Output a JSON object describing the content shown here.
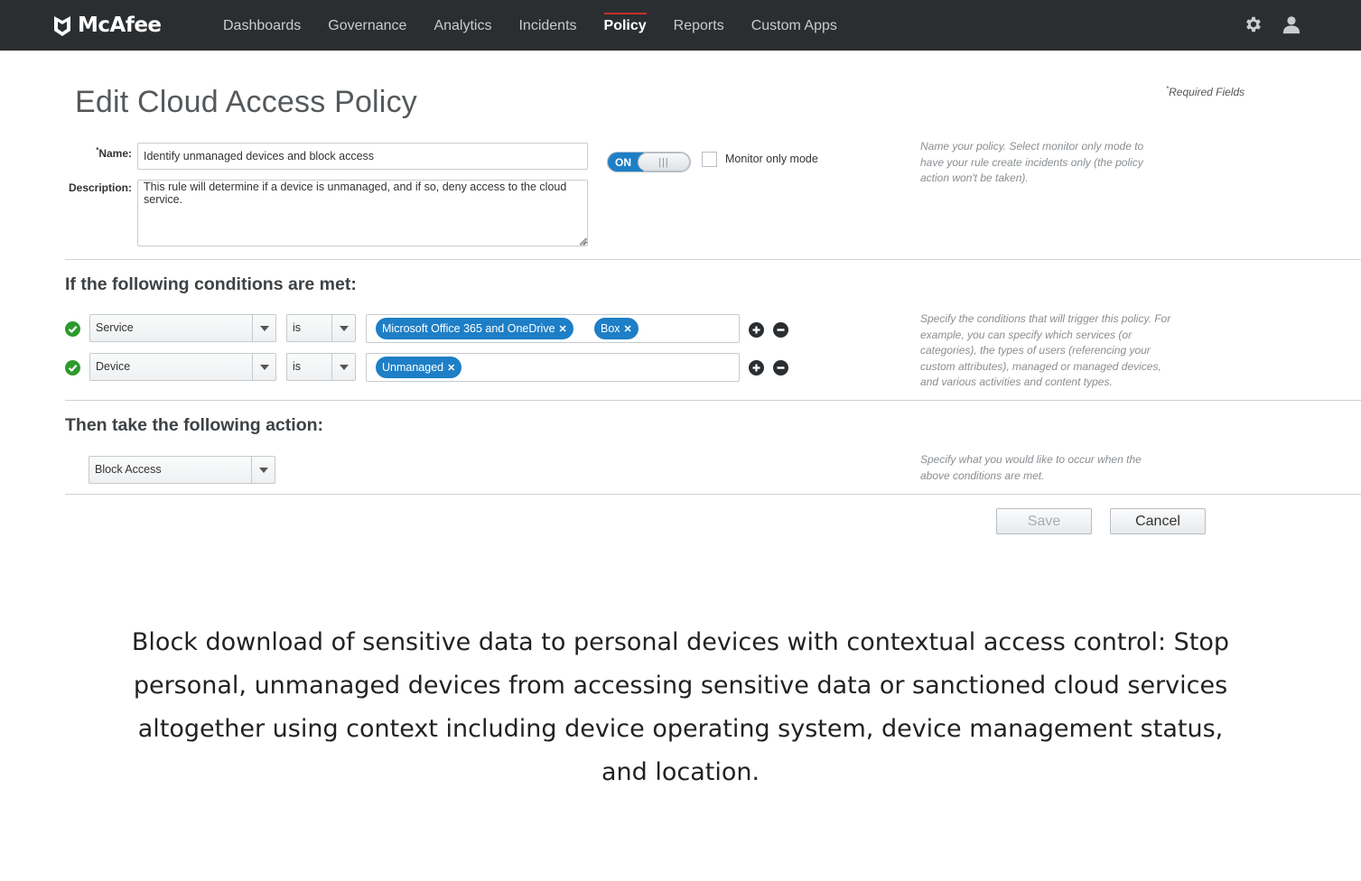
{
  "brand": {
    "name": "McAfee"
  },
  "nav": {
    "items": [
      {
        "label": "Dashboards"
      },
      {
        "label": "Governance"
      },
      {
        "label": "Analytics"
      },
      {
        "label": "Incidents"
      },
      {
        "label": "Policy",
        "active": true
      },
      {
        "label": "Reports"
      },
      {
        "label": "Custom Apps"
      }
    ],
    "icons": [
      "gear-icon",
      "user-icon"
    ]
  },
  "page": {
    "title": "Edit Cloud Access Policy",
    "required_note": "Required Fields",
    "required_mark": "*"
  },
  "form": {
    "name_label": "Name:",
    "name_value": "Identify unmanaged devices and block access",
    "description_label": "Description:",
    "description_value": "This rule will determine if a device is unmanaged, and if so, deny access to the cloud service.",
    "toggle_label": "ON",
    "toggle_state": true,
    "monitor_label": "Monitor only mode",
    "monitor_checked": false,
    "help": "Name your policy. Select monitor only mode to have your rule create incidents only (the policy action won't be taken)."
  },
  "conditions": {
    "title": "If the following conditions are met:",
    "rows": [
      {
        "field": "Service",
        "operator": "is",
        "tags": [
          "Microsoft Office 365 and OneDrive",
          "Box"
        ]
      },
      {
        "field": "Device",
        "operator": "is",
        "tags": [
          "Unmanaged"
        ]
      }
    ],
    "help": "Specify the conditions that will trigger this policy. For example, you can specify which services (or categories), the types of users (referencing your custom attributes), managed or managed devices, and various activities and content types."
  },
  "action": {
    "title": "Then take the following action:",
    "value": "Block Access",
    "help": "Specify what you would like to occur when the above conditions are met."
  },
  "buttons": {
    "save": "Save",
    "cancel": "Cancel"
  },
  "caption": "Block download of sensitive data to personal devices with contextual access control: Stop personal, unmanaged devices from accessing sensitive data or sanctioned cloud services altogether using context including device operating system, device management status, and location.",
  "colors": {
    "topbar": "#2b2e31",
    "accent": "#1e7fc6",
    "active_nav": "#c62f2f",
    "ok": "#2e9a2e"
  }
}
